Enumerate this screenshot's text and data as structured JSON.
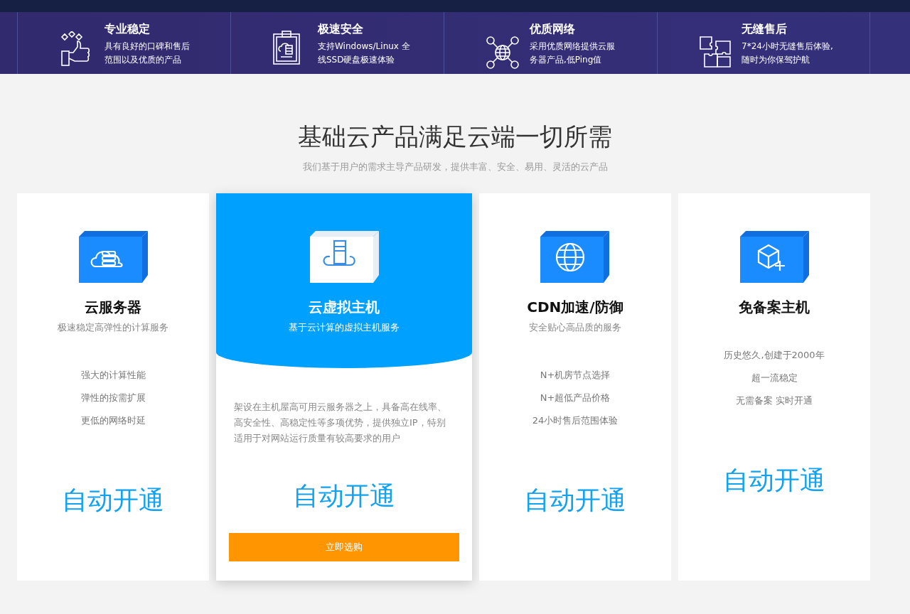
{
  "features": [
    {
      "title": "专业稳定",
      "lines": [
        "具有良好的口碑和售后",
        "范围以及优质的产品"
      ]
    },
    {
      "title": "极速安全",
      "lines": [
        "支持Windows/Linux 全",
        "线SSD硬盘极速体验"
      ]
    },
    {
      "title": "优质网络",
      "lines": [
        "采用优质网络提供云服",
        "务器产品,低Ping值"
      ]
    },
    {
      "title": "无缝售后",
      "lines": [
        "7*24小时无缝售后体验,",
        "随时为你保驾护航"
      ]
    }
  ],
  "section": {
    "title": "基础云产品满足云端一切所需",
    "subtitle": "我们基于用户的需求主导产品研发，提供丰富、安全、易用、灵活的云产品"
  },
  "products": [
    {
      "kind": "standard",
      "title": "云服务器",
      "subtitle": "极速稳定高弹性的计算服务",
      "points": [
        "强大的计算性能",
        "弹性的按需扩展",
        "更低的网络时延"
      ],
      "cta": "自动开通"
    },
    {
      "kind": "featured",
      "title": "云虚拟主机",
      "subtitle": "基于云计算的虚拟主机服务",
      "description": "架设在主机屋高可用云服务器之上，具备高在线率、高安全性、高稳定性等多项优势，提供独立IP，特别适用于对网站运行质量有较高要求的用户",
      "cta": "自动开通",
      "button": "立即选购"
    },
    {
      "kind": "standard",
      "title": "CDN加速/防御",
      "subtitle": "安全贴心高品质的服务",
      "points": [
        "N+机房节点选择",
        "N+超低产品价格",
        "24小时售后范围体验"
      ],
      "cta": "自动开通"
    },
    {
      "kind": "standard",
      "title": "免备案主机",
      "points": [
        "历史悠久,创建于2000年",
        "超一流稳定",
        "无需备案 实时开通"
      ],
      "cta": "自动开通"
    }
  ]
}
